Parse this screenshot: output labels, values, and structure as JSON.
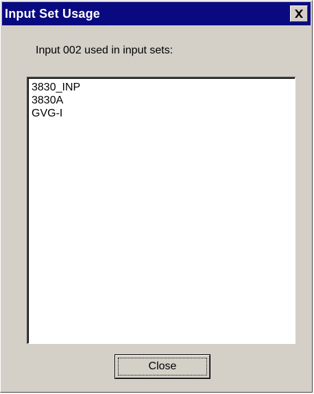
{
  "window": {
    "title": "Input Set Usage",
    "close_glyph": "close-icon"
  },
  "prompt": "Input 002 used in input sets:",
  "input_sets": [
    "3830_INP",
    "3830A",
    "GVG-I"
  ],
  "buttons": {
    "close_label": "Close"
  },
  "colors": {
    "title_bar": "#0a0a80",
    "face": "#d4d0c8",
    "list_bg": "#ffffff"
  }
}
